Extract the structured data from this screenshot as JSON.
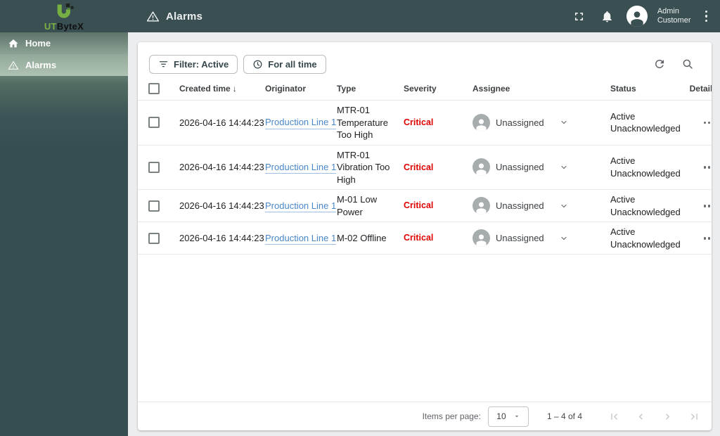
{
  "brand": {
    "prefix": "UT",
    "suffix": "ByteX"
  },
  "header": {
    "title": "Alarms",
    "user": {
      "line1": "Admin",
      "line2": "Customer"
    }
  },
  "sidebar": {
    "items": [
      {
        "label": "Home",
        "icon": "home-icon",
        "active": false
      },
      {
        "label": "Alarms",
        "icon": "warning-icon",
        "active": true
      }
    ]
  },
  "toolbar": {
    "filter_label": "Filter: Active",
    "time_label": "For all time"
  },
  "icons": {
    "sort_desc": "↓",
    "fullscreen": "expand-corners",
    "notifications": "bell",
    "more_vert": "kebab-dots",
    "refresh": "circular-arrow",
    "search": "magnifier"
  },
  "table": {
    "columns": [
      "Created time",
      "Originator",
      "Type",
      "Severity",
      "Assignee",
      "Status",
      "Details"
    ],
    "rows": [
      {
        "created": "2026-04-16 14:44:23",
        "originator": "Production Line 1",
        "type": "MTR-01 Temperature Too High",
        "severity": "Critical",
        "assignee": "Unassigned",
        "status_line1": "Active",
        "status_line2": "Unacknowledged"
      },
      {
        "created": "2026-04-16 14:44:23",
        "originator": "Production Line 1",
        "type": "MTR-01 Vibration Too High",
        "severity": "Critical",
        "assignee": "Unassigned",
        "status_line1": "Active",
        "status_line2": "Unacknowledged"
      },
      {
        "created": "2026-04-16 14:44:23",
        "originator": "Production Line 1",
        "type": "M-01 Low Power",
        "severity": "Critical",
        "assignee": "Unassigned",
        "status_line1": "Active",
        "status_line2": "Unacknowledged"
      },
      {
        "created": "2026-04-16 14:44:23",
        "originator": "Production Line 1",
        "type": "M-02 Offline",
        "severity": "Critical",
        "assignee": "Unassigned",
        "status_line1": "Active",
        "status_line2": "Unacknowledged"
      }
    ]
  },
  "pagination": {
    "items_per_page_label": "Items per page:",
    "page_size": "10",
    "range": "1 – 4 of 4"
  },
  "colors": {
    "topbar": "#3a4f52",
    "sidebar_dark": "#364e50",
    "accent_green": "#7cb342",
    "critical_red": "#e00000",
    "link_blue": "#4a87c7"
  }
}
